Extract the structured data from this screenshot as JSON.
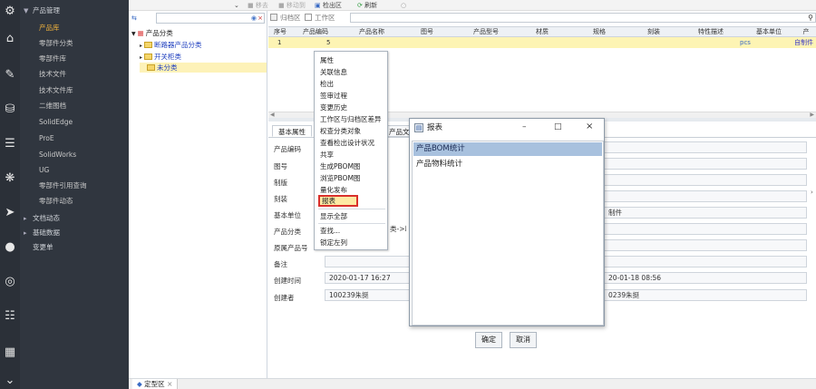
{
  "nav": {
    "header": "产品管理",
    "items": [
      "产品库",
      "零部件分类",
      "零部件库",
      "技术文件",
      "技术文件库",
      "二维图档",
      "SolidEdge",
      "ProE",
      "SolidWorks",
      "UG",
      "零部件引用查询",
      "零部件动态"
    ],
    "groups": [
      "文档动态",
      "基础数据",
      "变更单"
    ]
  },
  "toolbar": {
    "move_out": "移去",
    "move_in": "移动到",
    "checkout": "检出区",
    "refresh": "刷新"
  },
  "tree": {
    "root": "产品分类",
    "children": [
      "断路器产品分类",
      "开关柜类",
      "未分类"
    ]
  },
  "filter": {
    "archive": "归档区",
    "workspace": "工作区"
  },
  "grid": {
    "columns": [
      "序号",
      "产品编码",
      "产品名称",
      "图号",
      "产品型号",
      "材质",
      "规格",
      "刻装",
      "特性描述",
      "基本单位",
      "产"
    ],
    "rows": [
      {
        "seq": "1",
        "code": "5",
        "unit": "pcs",
        "extra": "自制件"
      }
    ]
  },
  "form": {
    "tabs": [
      "基本属性",
      "产品文"
    ],
    "labels": [
      "产品编码",
      "图号",
      "制版",
      "刻装",
      "基本单位",
      "产品分类",
      "原属产品号",
      "备注",
      "创建时间",
      "创建者"
    ],
    "values": {
      "category_tail": "类->断路",
      "created": "2020-01-17 16:27",
      "creator": "100239朱挺",
      "right_type": "制件",
      "right_time": "20-01-18 08:56",
      "right_user": "0239朱挺"
    }
  },
  "context_menu": {
    "items": [
      "属性",
      "关联信息",
      "检出",
      "签审过程",
      "变更历史",
      "工作区与归档区差异",
      "权查分类对象",
      "查看检出设计状况",
      "共享",
      "生成PBOM图",
      "浏览PBOM图",
      "量化发布",
      "报表",
      "显示全部",
      "查找...",
      "锁定左列"
    ],
    "highlighted_index": 12
  },
  "dialog": {
    "title": "报表",
    "items": [
      "产品BOM统计",
      "产品物料统计"
    ],
    "selected_index": 0,
    "ok": "确定",
    "cancel": "取消"
  },
  "bottom_tab": {
    "label": "定型区"
  }
}
